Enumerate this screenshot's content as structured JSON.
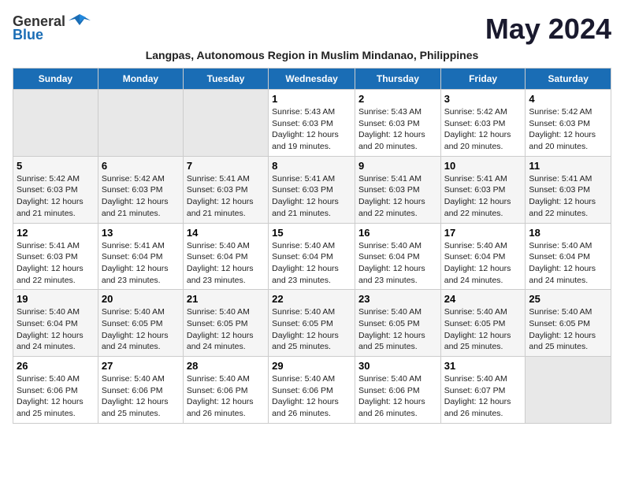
{
  "header": {
    "logo_general": "General",
    "logo_blue": "Blue",
    "month_title": "May 2024",
    "subtitle": "Langpas, Autonomous Region in Muslim Mindanao, Philippines"
  },
  "days_of_week": [
    "Sunday",
    "Monday",
    "Tuesday",
    "Wednesday",
    "Thursday",
    "Friday",
    "Saturday"
  ],
  "weeks": [
    [
      {
        "day": "",
        "sunrise": "",
        "sunset": "",
        "daylight": ""
      },
      {
        "day": "",
        "sunrise": "",
        "sunset": "",
        "daylight": ""
      },
      {
        "day": "",
        "sunrise": "",
        "sunset": "",
        "daylight": ""
      },
      {
        "day": "1",
        "sunrise": "Sunrise: 5:43 AM",
        "sunset": "Sunset: 6:03 PM",
        "daylight": "Daylight: 12 hours and 19 minutes."
      },
      {
        "day": "2",
        "sunrise": "Sunrise: 5:43 AM",
        "sunset": "Sunset: 6:03 PM",
        "daylight": "Daylight: 12 hours and 20 minutes."
      },
      {
        "day": "3",
        "sunrise": "Sunrise: 5:42 AM",
        "sunset": "Sunset: 6:03 PM",
        "daylight": "Daylight: 12 hours and 20 minutes."
      },
      {
        "day": "4",
        "sunrise": "Sunrise: 5:42 AM",
        "sunset": "Sunset: 6:03 PM",
        "daylight": "Daylight: 12 hours and 20 minutes."
      }
    ],
    [
      {
        "day": "5",
        "sunrise": "Sunrise: 5:42 AM",
        "sunset": "Sunset: 6:03 PM",
        "daylight": "Daylight: 12 hours and 21 minutes."
      },
      {
        "day": "6",
        "sunrise": "Sunrise: 5:42 AM",
        "sunset": "Sunset: 6:03 PM",
        "daylight": "Daylight: 12 hours and 21 minutes."
      },
      {
        "day": "7",
        "sunrise": "Sunrise: 5:41 AM",
        "sunset": "Sunset: 6:03 PM",
        "daylight": "Daylight: 12 hours and 21 minutes."
      },
      {
        "day": "8",
        "sunrise": "Sunrise: 5:41 AM",
        "sunset": "Sunset: 6:03 PM",
        "daylight": "Daylight: 12 hours and 21 minutes."
      },
      {
        "day": "9",
        "sunrise": "Sunrise: 5:41 AM",
        "sunset": "Sunset: 6:03 PM",
        "daylight": "Daylight: 12 hours and 22 minutes."
      },
      {
        "day": "10",
        "sunrise": "Sunrise: 5:41 AM",
        "sunset": "Sunset: 6:03 PM",
        "daylight": "Daylight: 12 hours and 22 minutes."
      },
      {
        "day": "11",
        "sunrise": "Sunrise: 5:41 AM",
        "sunset": "Sunset: 6:03 PM",
        "daylight": "Daylight: 12 hours and 22 minutes."
      }
    ],
    [
      {
        "day": "12",
        "sunrise": "Sunrise: 5:41 AM",
        "sunset": "Sunset: 6:03 PM",
        "daylight": "Daylight: 12 hours and 22 minutes."
      },
      {
        "day": "13",
        "sunrise": "Sunrise: 5:41 AM",
        "sunset": "Sunset: 6:04 PM",
        "daylight": "Daylight: 12 hours and 23 minutes."
      },
      {
        "day": "14",
        "sunrise": "Sunrise: 5:40 AM",
        "sunset": "Sunset: 6:04 PM",
        "daylight": "Daylight: 12 hours and 23 minutes."
      },
      {
        "day": "15",
        "sunrise": "Sunrise: 5:40 AM",
        "sunset": "Sunset: 6:04 PM",
        "daylight": "Daylight: 12 hours and 23 minutes."
      },
      {
        "day": "16",
        "sunrise": "Sunrise: 5:40 AM",
        "sunset": "Sunset: 6:04 PM",
        "daylight": "Daylight: 12 hours and 23 minutes."
      },
      {
        "day": "17",
        "sunrise": "Sunrise: 5:40 AM",
        "sunset": "Sunset: 6:04 PM",
        "daylight": "Daylight: 12 hours and 24 minutes."
      },
      {
        "day": "18",
        "sunrise": "Sunrise: 5:40 AM",
        "sunset": "Sunset: 6:04 PM",
        "daylight": "Daylight: 12 hours and 24 minutes."
      }
    ],
    [
      {
        "day": "19",
        "sunrise": "Sunrise: 5:40 AM",
        "sunset": "Sunset: 6:04 PM",
        "daylight": "Daylight: 12 hours and 24 minutes."
      },
      {
        "day": "20",
        "sunrise": "Sunrise: 5:40 AM",
        "sunset": "Sunset: 6:05 PM",
        "daylight": "Daylight: 12 hours and 24 minutes."
      },
      {
        "day": "21",
        "sunrise": "Sunrise: 5:40 AM",
        "sunset": "Sunset: 6:05 PM",
        "daylight": "Daylight: 12 hours and 24 minutes."
      },
      {
        "day": "22",
        "sunrise": "Sunrise: 5:40 AM",
        "sunset": "Sunset: 6:05 PM",
        "daylight": "Daylight: 12 hours and 25 minutes."
      },
      {
        "day": "23",
        "sunrise": "Sunrise: 5:40 AM",
        "sunset": "Sunset: 6:05 PM",
        "daylight": "Daylight: 12 hours and 25 minutes."
      },
      {
        "day": "24",
        "sunrise": "Sunrise: 5:40 AM",
        "sunset": "Sunset: 6:05 PM",
        "daylight": "Daylight: 12 hours and 25 minutes."
      },
      {
        "day": "25",
        "sunrise": "Sunrise: 5:40 AM",
        "sunset": "Sunset: 6:05 PM",
        "daylight": "Daylight: 12 hours and 25 minutes."
      }
    ],
    [
      {
        "day": "26",
        "sunrise": "Sunrise: 5:40 AM",
        "sunset": "Sunset: 6:06 PM",
        "daylight": "Daylight: 12 hours and 25 minutes."
      },
      {
        "day": "27",
        "sunrise": "Sunrise: 5:40 AM",
        "sunset": "Sunset: 6:06 PM",
        "daylight": "Daylight: 12 hours and 25 minutes."
      },
      {
        "day": "28",
        "sunrise": "Sunrise: 5:40 AM",
        "sunset": "Sunset: 6:06 PM",
        "daylight": "Daylight: 12 hours and 26 minutes."
      },
      {
        "day": "29",
        "sunrise": "Sunrise: 5:40 AM",
        "sunset": "Sunset: 6:06 PM",
        "daylight": "Daylight: 12 hours and 26 minutes."
      },
      {
        "day": "30",
        "sunrise": "Sunrise: 5:40 AM",
        "sunset": "Sunset: 6:06 PM",
        "daylight": "Daylight: 12 hours and 26 minutes."
      },
      {
        "day": "31",
        "sunrise": "Sunrise: 5:40 AM",
        "sunset": "Sunset: 6:07 PM",
        "daylight": "Daylight: 12 hours and 26 minutes."
      },
      {
        "day": "",
        "sunrise": "",
        "sunset": "",
        "daylight": ""
      }
    ]
  ]
}
